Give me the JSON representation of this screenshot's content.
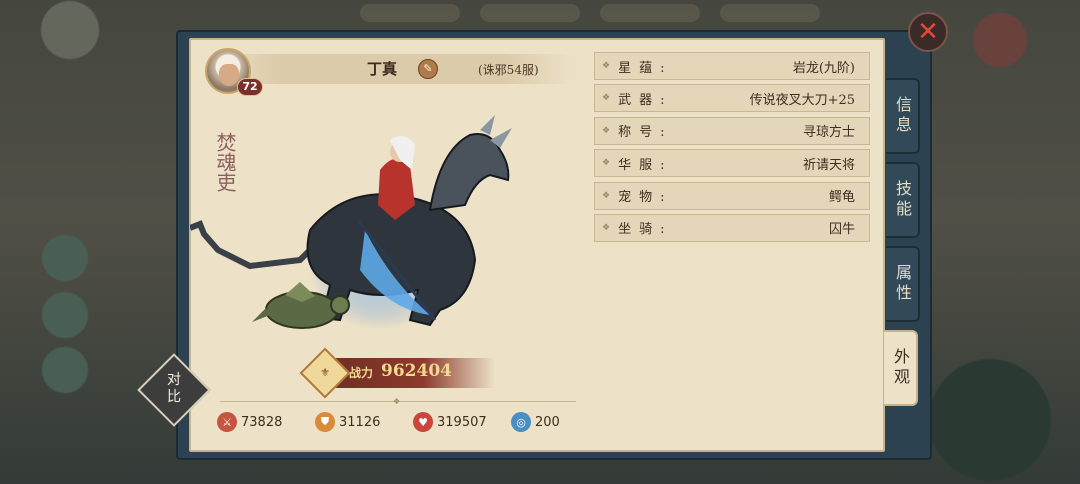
{
  "header": {
    "name": "丁真",
    "server": "(诛邪54服)",
    "level": "72",
    "vertical_title": "焚魂吏"
  },
  "combat_power": {
    "label": "战力",
    "value": "962404"
  },
  "stats": [
    {
      "icon": "attack-icon",
      "value": "73828",
      "color": "#c5553f"
    },
    {
      "icon": "defense-icon",
      "value": "31126",
      "color": "#d98a3a"
    },
    {
      "icon": "health-icon",
      "value": "319507",
      "color": "#c9463d"
    },
    {
      "icon": "speed-icon",
      "value": "200",
      "color": "#4a8ec4"
    }
  ],
  "info_rows": [
    {
      "label": "星蕴:",
      "value": "岩龙(九阶)"
    },
    {
      "label": "武器:",
      "value": "传说夜叉大刀+25"
    },
    {
      "label": "称号:",
      "value": "寻琼方士"
    },
    {
      "label": "华服:",
      "value": "祈请天将"
    },
    {
      "label": "宠物:",
      "value": "鳄龟"
    },
    {
      "label": "坐骑:",
      "value": "囚牛"
    }
  ],
  "tabs": [
    {
      "label": "信息",
      "active": false
    },
    {
      "label": "技能",
      "active": false
    },
    {
      "label": "属性",
      "active": false
    },
    {
      "label": "外观",
      "active": true
    }
  ],
  "compare_label": "对比",
  "close_icon": "close-icon",
  "colors": {
    "panel": "#2d4250",
    "paper": "#ede2c8",
    "accent": "#7a2f2a",
    "power_text": "#f4d790"
  }
}
